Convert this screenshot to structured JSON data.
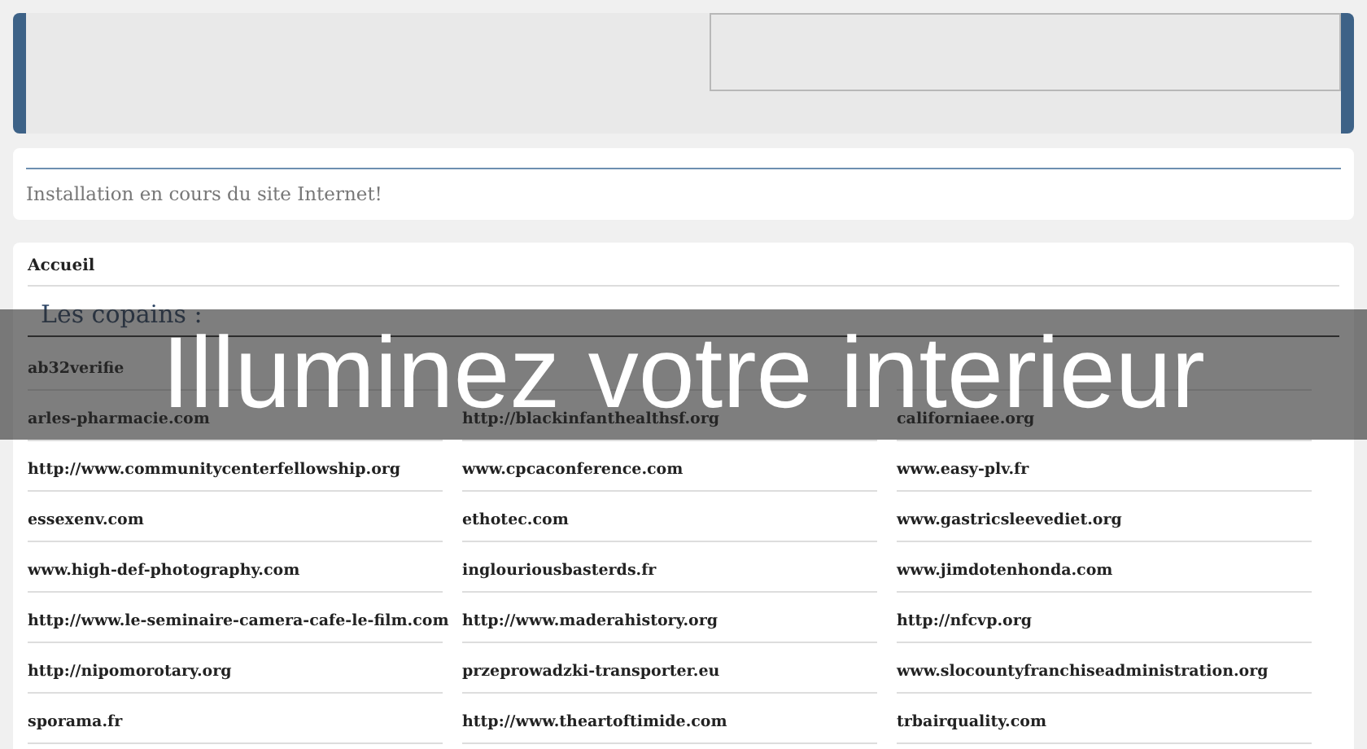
{
  "notice": {
    "text": "Installation en cours du site Internet!"
  },
  "menu": {
    "items": [
      {
        "label": "Accueil"
      }
    ]
  },
  "friends": {
    "title": "Les copains :",
    "links": [
      {
        "kind": "link",
        "text": "ab32verifie"
      },
      {
        "kind": "covered"
      },
      {
        "kind": "covered"
      },
      {
        "kind": "link",
        "text": "arles-pharmacie.com"
      },
      {
        "kind": "link",
        "text": "http://blackinfanthealthsf.org"
      },
      {
        "kind": "link",
        "text": "californiaee.org"
      },
      {
        "kind": "link",
        "text": "http://www.communitycenterfellowship.org"
      },
      {
        "kind": "link",
        "text": "www.cpcaconference.com"
      },
      {
        "kind": "link",
        "text": "www.easy-plv.fr"
      },
      {
        "kind": "link",
        "text": "essexenv.com"
      },
      {
        "kind": "link",
        "text": "ethotec.com"
      },
      {
        "kind": "link",
        "text": "www.gastricsleevediet.org"
      },
      {
        "kind": "link",
        "text": "www.high-def-photography.com"
      },
      {
        "kind": "link",
        "text": "inglouriousbasterds.fr"
      },
      {
        "kind": "link",
        "text": "www.jimdotenhonda.com"
      },
      {
        "kind": "link",
        "text": "http://www.le-seminaire-camera-cafe-le-film.com"
      },
      {
        "kind": "link",
        "text": "http://www.maderahistory.org"
      },
      {
        "kind": "link",
        "text": "http://nfcvp.org"
      },
      {
        "kind": "link",
        "text": "http://nipomorotary.org"
      },
      {
        "kind": "link",
        "text": "przeprowadzki-transporter.eu"
      },
      {
        "kind": "link",
        "text": "www.slocountyfranchiseadministration.org"
      },
      {
        "kind": "link",
        "text": "sporama.fr"
      },
      {
        "kind": "link",
        "text": "http://www.theartoftimide.com"
      },
      {
        "kind": "link",
        "text": "trbairquality.com"
      }
    ]
  },
  "banner": {
    "text": "Illuminez votre interieur"
  }
}
